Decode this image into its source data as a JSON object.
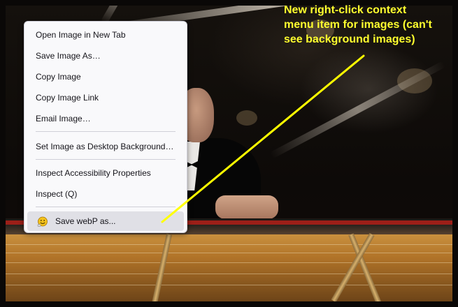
{
  "context_menu": {
    "items": [
      {
        "label": "Open Image in New Tab",
        "icon": null
      },
      {
        "label": "Save Image As…",
        "icon": null
      },
      {
        "label": "Copy Image",
        "icon": null
      },
      {
        "label": "Copy Image Link",
        "icon": null
      },
      {
        "label": "Email Image…",
        "icon": null
      },
      {
        "label": "Set Image as Desktop Background…",
        "icon": null
      },
      {
        "label": "Inspect Accessibility Properties",
        "icon": null
      },
      {
        "label": "Inspect (Q)",
        "icon": null
      },
      {
        "label": "Save webP as...",
        "icon": "smiley-icon",
        "hovered": true
      }
    ]
  },
  "annotation": {
    "text": "New right-click context\nmenu item for images (can't\nsee background images)",
    "color": "#ffff2e"
  },
  "colors": {
    "menu_background": "#f9f9fb",
    "menu_hover": "#e0e0e6",
    "annotation_arrow": "#ffff00"
  }
}
